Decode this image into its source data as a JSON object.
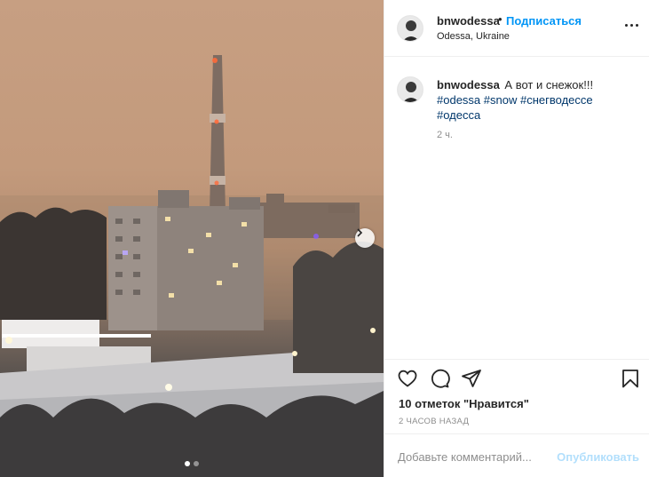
{
  "post": {
    "username": "bnwodessa",
    "separator": "•",
    "follow_label": "Подписаться",
    "location": "Odessa, Ukraine",
    "caption_user": "bnwodessa",
    "caption_text": "А вот и снежок!!!",
    "hashtags_line1": [
      "#odessa",
      "#snow",
      "#снегводессе"
    ],
    "hashtags_line2": [
      "#одесса"
    ],
    "caption_time": "2 ч.",
    "likes": "10 отметок \"Нравится\"",
    "posted_ago": "2 ЧАСОВ НАЗАД"
  },
  "comment": {
    "placeholder": "Добавьте комментарий...",
    "publish_label": "Опубликовать"
  },
  "carousel": {
    "slide_count": 2,
    "active_index": 0
  },
  "icons": [
    "heart-icon",
    "comment-icon",
    "share-icon",
    "bookmark-icon",
    "more-icon",
    "chevron-right-icon"
  ],
  "colors": {
    "link": "#0095f6",
    "hashtag": "#00376b",
    "publish_disabled": "#b2dffc",
    "muted": "#8e8e8e"
  }
}
